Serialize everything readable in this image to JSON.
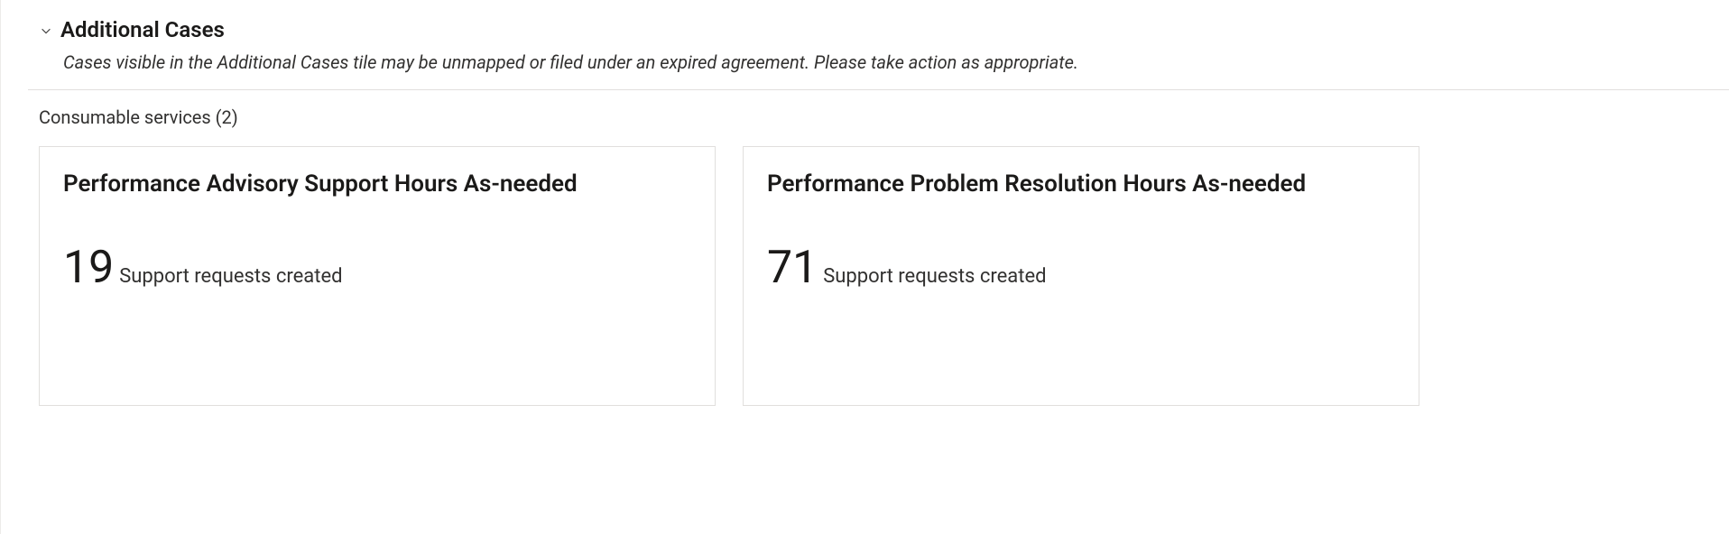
{
  "section": {
    "title": "Additional Cases",
    "subtitle": "Cases visible in the Additional Cases tile may be unmapped or filed under an expired agreement. Please take action as appropriate."
  },
  "subsection": {
    "label": "Consumable services (2)"
  },
  "tiles": [
    {
      "title": "Performance Advisory Support Hours As-needed",
      "count": "19",
      "countLabel": "Support requests created"
    },
    {
      "title": "Performance Problem Resolution Hours As-needed",
      "count": "71",
      "countLabel": "Support requests created"
    }
  ]
}
